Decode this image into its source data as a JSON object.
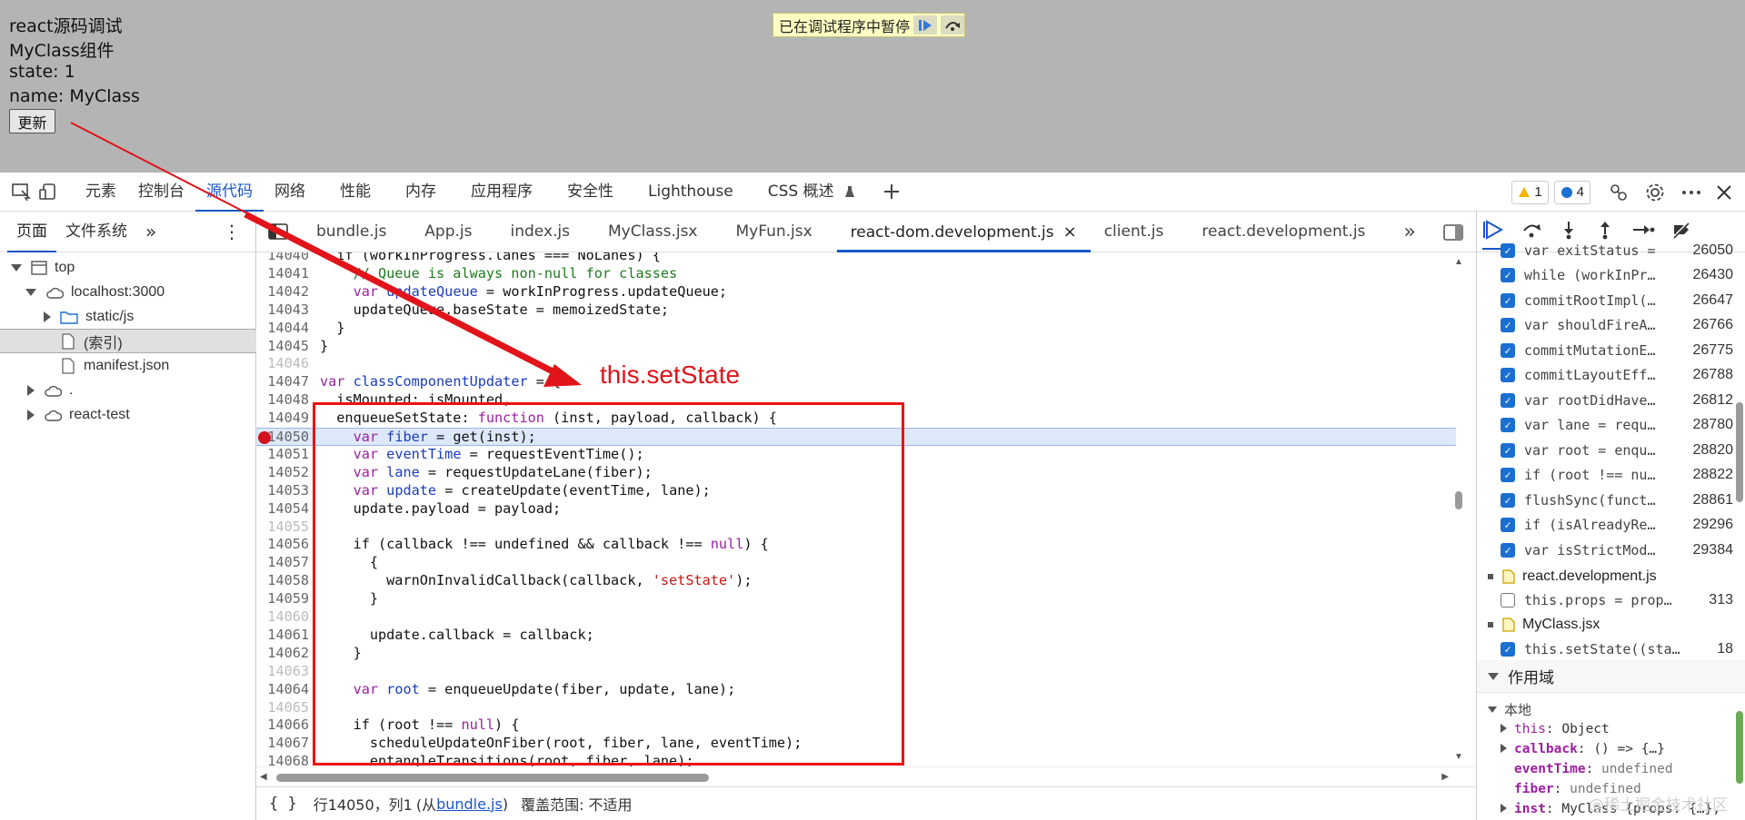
{
  "app": {
    "lines": [
      "react源码调试",
      "MyClass组件",
      "state: 1",
      "name: MyClass"
    ],
    "update_button": "更新"
  },
  "paused_banner": {
    "text": "已在调试程序中暂停"
  },
  "devtools": {
    "tabs": [
      "元素",
      "控制台",
      "源代码",
      "网络",
      "性能",
      "内存",
      "应用程序",
      "安全性",
      "Lighthouse",
      "CSS 概述"
    ],
    "active_tab": "源代码",
    "warnings": "1",
    "messages": "4"
  },
  "navigator": {
    "tabs": [
      "页面",
      "文件系统"
    ],
    "tree": [
      {
        "label": "top",
        "icon": "frame"
      },
      {
        "label": "localhost:3000",
        "icon": "cloud"
      },
      {
        "label": "static/js",
        "icon": "folder"
      },
      {
        "label": "(索引)",
        "icon": "file"
      },
      {
        "label": "manifest.json",
        "icon": "file"
      },
      {
        "label": ".",
        "icon": "cloud"
      },
      {
        "label": "react-test",
        "icon": "cloud"
      }
    ]
  },
  "editor": {
    "tabs": [
      "bundle.js",
      "App.js",
      "index.js",
      "MyClass.jsx",
      "MyFun.jsx",
      "react-dom.development.js",
      "client.js",
      "react.development.js"
    ],
    "active_tab": "react-dom.development.js",
    "annotation": "this.setState",
    "code": [
      {
        "n": "14040",
        "t": "  if (workInProgress.lanes === NoLanes) {"
      },
      {
        "n": "14041",
        "t": "    // Queue is always non-null for classes"
      },
      {
        "n": "14042",
        "t": "    var updateQueue = workInProgress.updateQueue;"
      },
      {
        "n": "14043",
        "t": "    updateQueue.baseState = memoizedState;"
      },
      {
        "n": "14044",
        "t": "  }"
      },
      {
        "n": "14045",
        "t": "}"
      },
      {
        "n": "14046",
        "t": ""
      },
      {
        "n": "14047",
        "t": "var classComponentUpdater = {"
      },
      {
        "n": "14048",
        "t": "  isMounted: isMounted,"
      },
      {
        "n": "14049",
        "t": "  enqueueSetState: function (inst, payload, callback) {"
      },
      {
        "n": "14050",
        "t": "    var fiber = get(inst);"
      },
      {
        "n": "14051",
        "t": "    var eventTime = requestEventTime();"
      },
      {
        "n": "14052",
        "t": "    var lane = requestUpdateLane(fiber);"
      },
      {
        "n": "14053",
        "t": "    var update = createUpdate(eventTime, lane);"
      },
      {
        "n": "14054",
        "t": "    update.payload = payload;"
      },
      {
        "n": "14055",
        "t": ""
      },
      {
        "n": "14056",
        "t": "    if (callback !== undefined && callback !== null) {"
      },
      {
        "n": "14057",
        "t": "      {"
      },
      {
        "n": "14058",
        "t": "        warnOnInvalidCallback(callback, 'setState');"
      },
      {
        "n": "14059",
        "t": "      }"
      },
      {
        "n": "14060",
        "t": ""
      },
      {
        "n": "14061",
        "t": "      update.callback = callback;"
      },
      {
        "n": "14062",
        "t": "    }"
      },
      {
        "n": "14063",
        "t": ""
      },
      {
        "n": "14064",
        "t": "    var root = enqueueUpdate(fiber, update, lane);"
      },
      {
        "n": "14065",
        "t": ""
      },
      {
        "n": "14066",
        "t": "    if (root !== null) {"
      },
      {
        "n": "14067",
        "t": "      scheduleUpdateOnFiber(root, fiber, lane, eventTime);"
      },
      {
        "n": "14068",
        "t": "      entangleTransitions(root, fiber, lane);"
      }
    ],
    "status": {
      "position": "行14050，列1",
      "from_prefix": "(从",
      "from_link": "bundle.js",
      "from_suffix": ")",
      "coverage": "覆盖范围: 不适用"
    }
  },
  "breakpoints": [
    {
      "text": "var exitStatus =",
      "line": "26050",
      "checked": true
    },
    {
      "text": "while (workInPr…",
      "line": "26430",
      "checked": true
    },
    {
      "text": "commitRootImpl(…",
      "line": "26647",
      "checked": true
    },
    {
      "text": "var shouldFireA…",
      "line": "26766",
      "checked": true
    },
    {
      "text": "commitMutationE…",
      "line": "26775",
      "checked": true
    },
    {
      "text": "commitLayoutEff…",
      "line": "26788",
      "checked": true
    },
    {
      "text": "var rootDidHave…",
      "line": "26812",
      "checked": true
    },
    {
      "text": "var lane = requ…",
      "line": "28780",
      "checked": true
    },
    {
      "text": "var root = enqu…",
      "line": "28820",
      "checked": true
    },
    {
      "text": "if (root !== nu…",
      "line": "28822",
      "checked": true
    },
    {
      "text": "flushSync(funct…",
      "line": "28861",
      "checked": true
    },
    {
      "text": "if (isAlreadyRe…",
      "line": "29296",
      "checked": true
    },
    {
      "text": "var isStrictMod…",
      "line": "29384",
      "checked": true
    }
  ],
  "bp_files": [
    {
      "name": "react.development.js",
      "items": [
        {
          "text": "this.props = prop…",
          "line": "313",
          "checked": false
        }
      ]
    },
    {
      "name": "MyClass.jsx",
      "items": [
        {
          "text": "this.setState((sta…",
          "line": "18",
          "checked": true
        }
      ]
    }
  ],
  "scope": {
    "title": "作用域",
    "local": "本地",
    "vars": [
      {
        "k": "this",
        "v": "Object",
        "exp": true,
        "bold": false
      },
      {
        "k": "callback",
        "v": "() => {…}",
        "exp": true,
        "bold": true
      },
      {
        "k": "eventTime",
        "v": "undefined",
        "exp": false,
        "bold": true
      },
      {
        "k": "fiber",
        "v": "undefined",
        "exp": false,
        "bold": true
      },
      {
        "k": "inst",
        "v": "MyClass {props: {…},",
        "exp": true,
        "bold": true
      }
    ]
  },
  "watermark": "@稀土掘金技术社区"
}
